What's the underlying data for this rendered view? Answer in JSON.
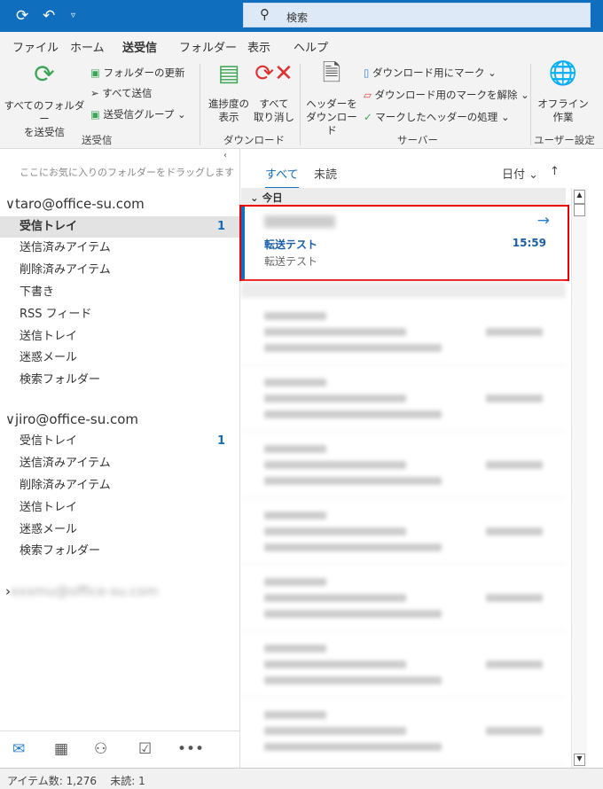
{
  "titlebar": {
    "search_placeholder": "検索"
  },
  "menu_tabs": [
    "ファイル",
    "ホーム",
    "送受信",
    "フォルダー",
    "表示",
    "ヘルプ"
  ],
  "ribbon": {
    "send_receive_all": [
      "すべてのフォルダー",
      "を送受信"
    ],
    "update_folder": "フォルダーの更新",
    "send_all": "すべて送信",
    "send_receive_groups": "送受信グループ",
    "group_send_receive": "送受信",
    "show_progress": [
      "進捗度の",
      "表示"
    ],
    "cancel_all": [
      "すべて",
      "取り消し"
    ],
    "group_download": "ダウンロード",
    "download_headers": [
      "ヘッダーを",
      "ダウンロード"
    ],
    "mark_download": "ダウンロード用にマーク",
    "unmark_download": "ダウンロード用のマークを解除",
    "process_marked": "マークしたヘッダーの処理",
    "group_server": "サーバー",
    "work_offline": [
      "オフライン",
      "作業"
    ],
    "group_preferences": "ユーザー設定"
  },
  "folder_pane": {
    "hint": "ここにお気に入りのフォルダーをドラッグします",
    "accounts": [
      {
        "name": "taro@office-su.com",
        "folders": [
          {
            "label": "受信トレイ",
            "count": "1",
            "selected": true
          },
          {
            "label": "送信済みアイテム"
          },
          {
            "label": "削除済みアイテム"
          },
          {
            "label": "下書き"
          },
          {
            "label": "RSS フィード"
          },
          {
            "label": "送信トレイ"
          },
          {
            "label": "迷惑メール"
          },
          {
            "label": "検索フォルダー"
          }
        ]
      },
      {
        "name": "jiro@office-su.com",
        "folders": [
          {
            "label": "受信トレイ",
            "count": "1"
          },
          {
            "label": "送信済みアイテム"
          },
          {
            "label": "削除済みアイテム"
          },
          {
            "label": "送信トレイ"
          },
          {
            "label": "迷惑メール"
          },
          {
            "label": "検索フォルダー"
          }
        ]
      },
      {
        "name": "xxxmu@office-su.com",
        "blurred": true
      }
    ]
  },
  "mail_list": {
    "tab_all": "すべて",
    "tab_unread": "未読",
    "sort": "日付",
    "group_today": "今日",
    "selected": {
      "subject": "転送テスト",
      "preview": "転送テスト",
      "time": "15:59",
      "icon": "forward-arrow-icon"
    }
  },
  "status": {
    "items": "アイテム数: 1,276",
    "unread": "未読: 1"
  },
  "colors": {
    "accent": "#106ebe",
    "highlight": "#e00000"
  }
}
